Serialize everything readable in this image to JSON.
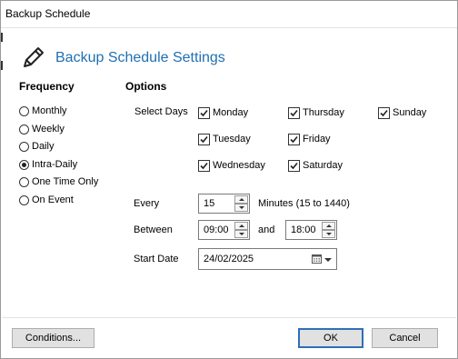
{
  "window": {
    "title": "Backup Schedule"
  },
  "header": {
    "title": "Backup Schedule Settings",
    "icon": "pencil-icon"
  },
  "frequency": {
    "heading": "Frequency",
    "options": [
      {
        "label": "Monthly",
        "checked": false
      },
      {
        "label": "Weekly",
        "checked": false
      },
      {
        "label": "Daily",
        "checked": false
      },
      {
        "label": "Intra-Daily",
        "checked": true
      },
      {
        "label": "One Time Only",
        "checked": false
      },
      {
        "label": "On Event",
        "checked": false
      }
    ]
  },
  "options": {
    "heading": "Options",
    "select_days_label": "Select Days",
    "days": [
      {
        "label": "Monday",
        "checked": true
      },
      {
        "label": "Tuesday",
        "checked": true
      },
      {
        "label": "Wednesday",
        "checked": true
      },
      {
        "label": "Thursday",
        "checked": true
      },
      {
        "label": "Friday",
        "checked": true
      },
      {
        "label": "Saturday",
        "checked": true
      },
      {
        "label": "Sunday",
        "checked": true
      }
    ],
    "every_label": "Every",
    "every_value": "15",
    "minutes_hint": "Minutes (15 to 1440)",
    "between_label": "Between",
    "between_start": "09:00",
    "and_label": "and",
    "between_end": "18:00",
    "start_date_label": "Start Date",
    "start_date_value": "24/02/2025"
  },
  "footer": {
    "conditions_label": "Conditions...",
    "ok_label": "OK",
    "cancel_label": "Cancel"
  },
  "colors": {
    "accent": "#1f6fb2",
    "default_button_border": "#2f6fb6"
  }
}
